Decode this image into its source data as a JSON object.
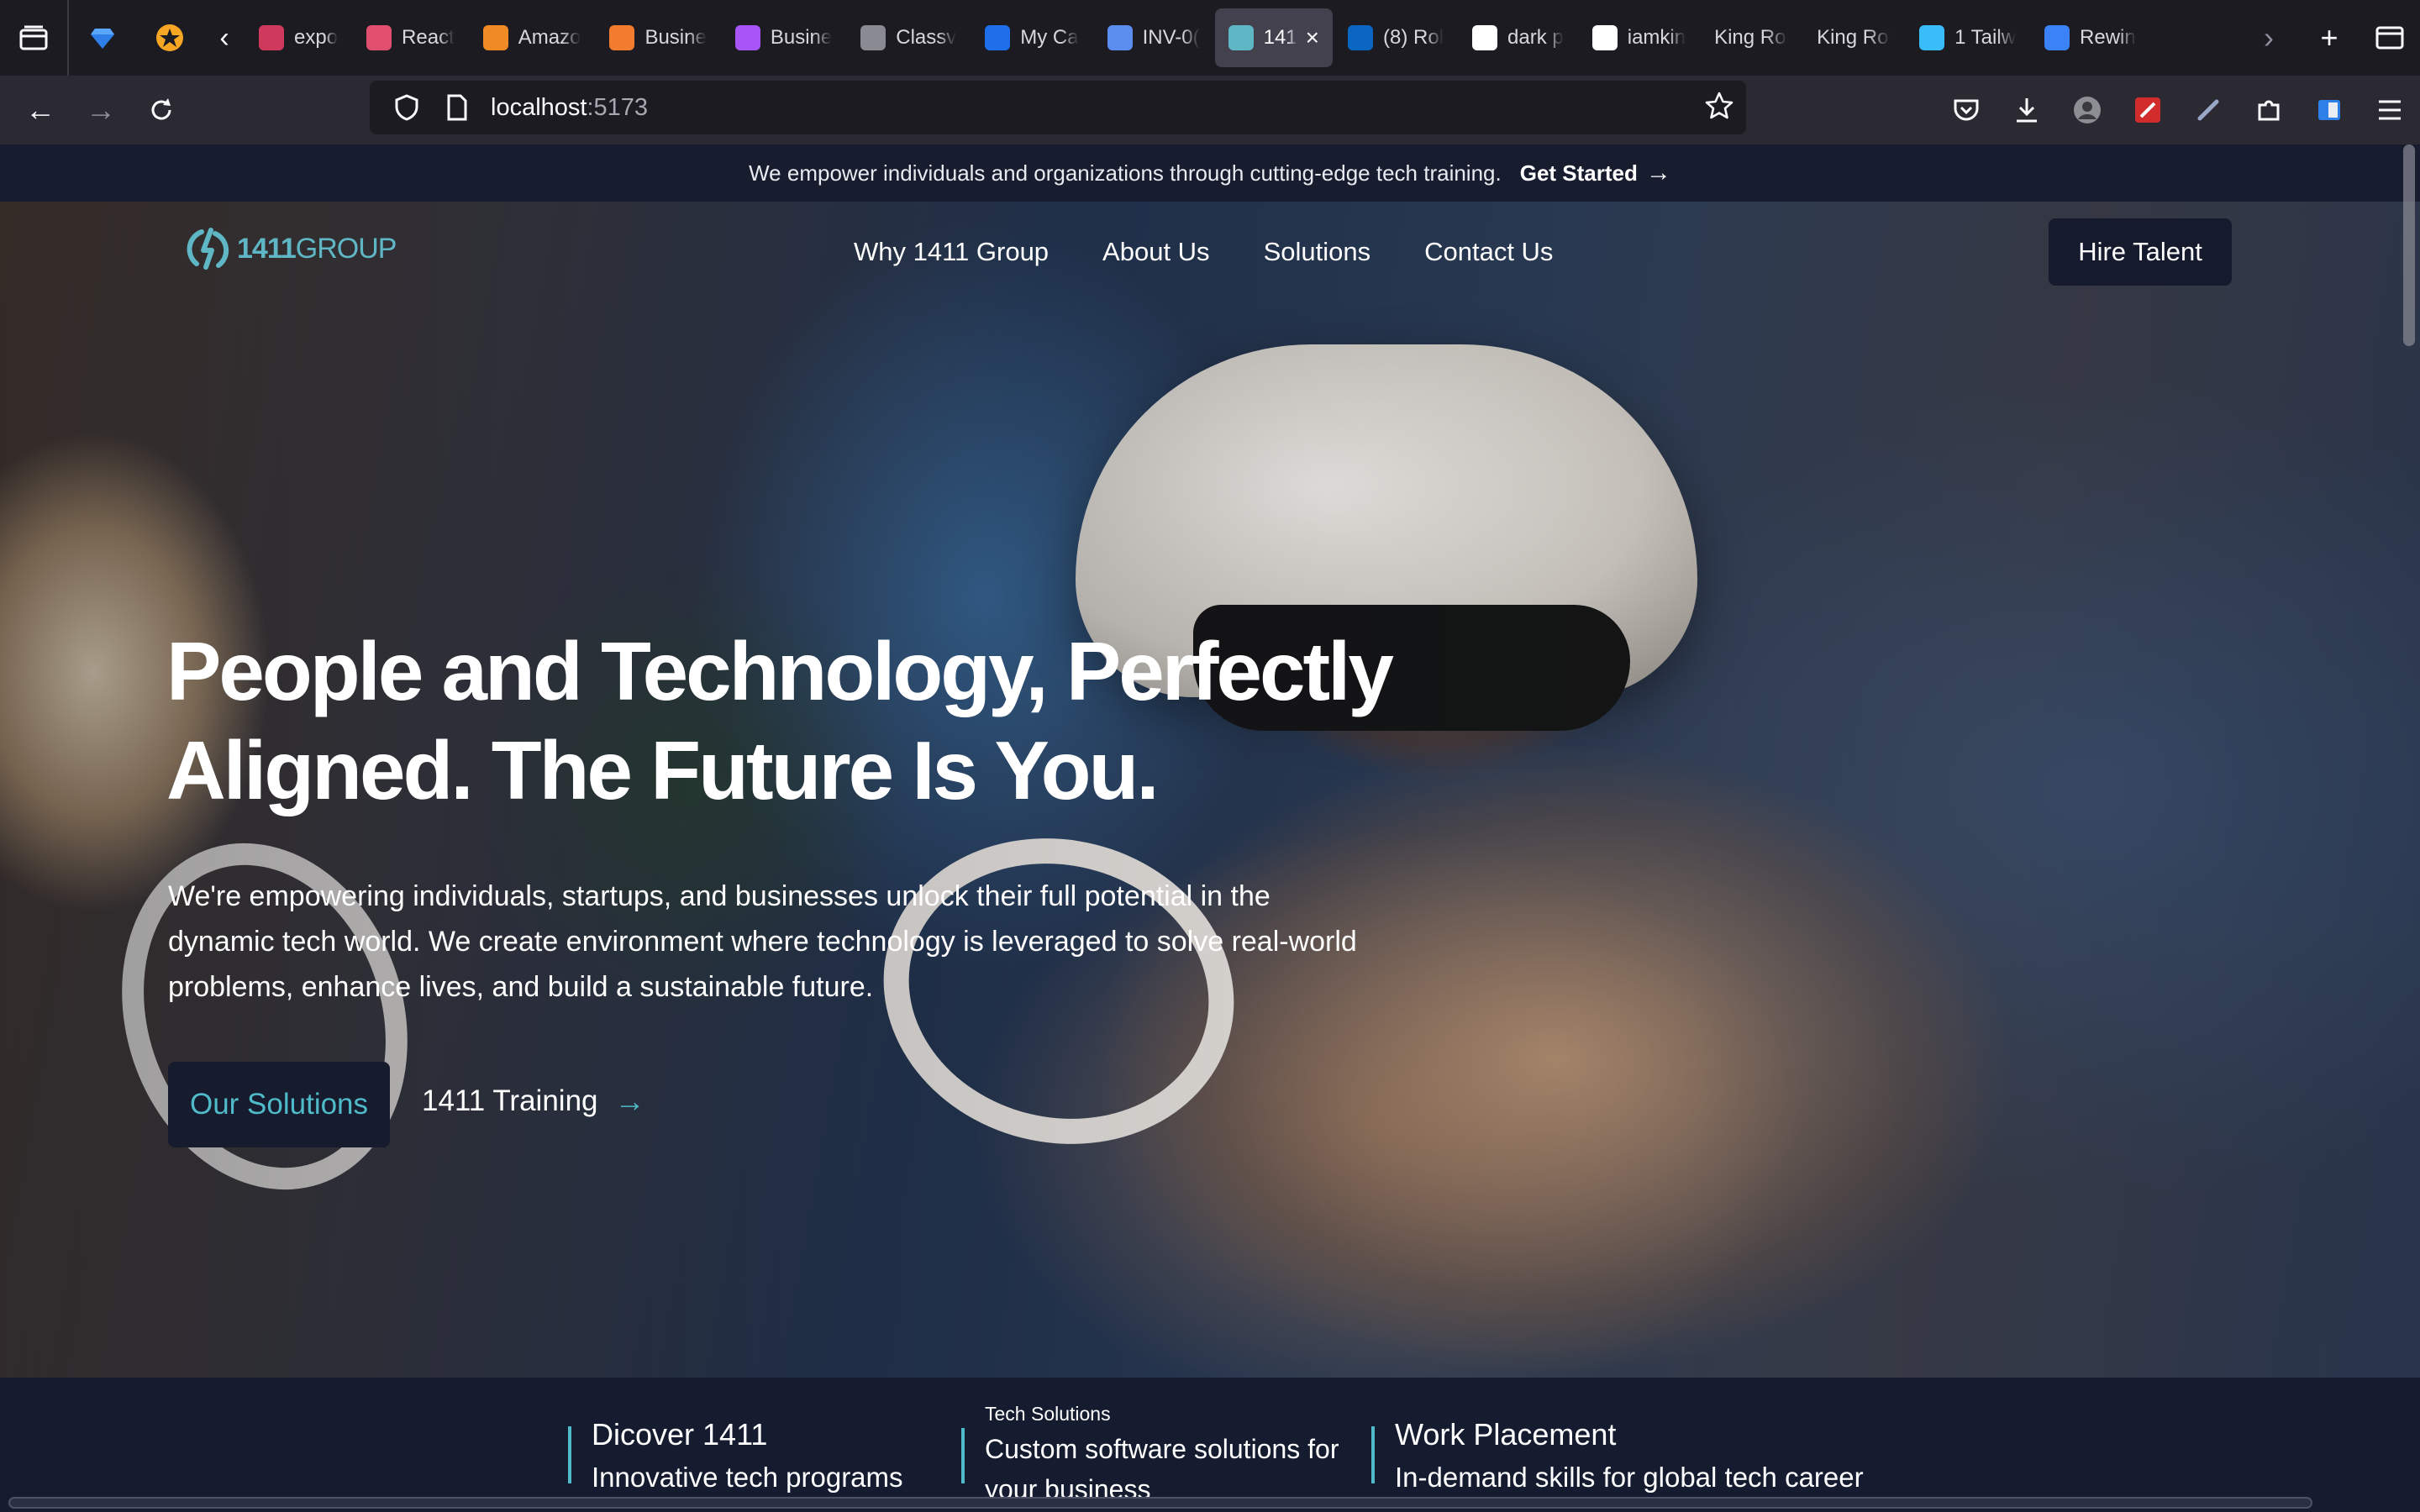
{
  "browser": {
    "tabs": [
      {
        "title": "expo",
        "favicon_color": "#cf3a5c",
        "icon": "expo-icon"
      },
      {
        "title": "React",
        "favicon_color": "#e04f6e",
        "icon": "react-icon"
      },
      {
        "title": "Amazo",
        "favicon_color": "#f08a24",
        "icon": "aws-icon"
      },
      {
        "title": "Busine",
        "favicon_color": "#f27b2e",
        "icon": "business-icon"
      },
      {
        "title": "Busine",
        "favicon_color": "#a855f7",
        "icon": "business-icon"
      },
      {
        "title": "Classv",
        "favicon_color": "#8a8a93",
        "icon": "classroom-icon"
      },
      {
        "title": "My Ca",
        "favicon_color": "#1f6feb",
        "icon": "calendly-icon"
      },
      {
        "title": "INV-0(",
        "favicon_color": "#5b8def",
        "icon": "invoice-icon"
      },
      {
        "title": "141",
        "favicon_color": "#5fb7c6",
        "icon": "1411-icon",
        "active": true
      },
      {
        "title": "(8) Rol",
        "favicon_color": "#0a66c2",
        "icon": "linkedin-icon"
      },
      {
        "title": "dark p",
        "favicon_color": "#ffffff",
        "icon": "google-icon"
      },
      {
        "title": "iamkin",
        "favicon_color": "#ffffff",
        "icon": "github-icon"
      },
      {
        "title": "King Robe",
        "favicon_color": "",
        "icon": ""
      },
      {
        "title": "King Robe",
        "favicon_color": "",
        "icon": ""
      },
      {
        "title": "1 Tailw",
        "favicon_color": "#38bdf8",
        "icon": "tailwind-icon"
      },
      {
        "title": "Rewin",
        "favicon_color": "#3b82f6",
        "icon": "dot-icon"
      }
    ],
    "url": {
      "host": "localhost",
      "port": ":5173"
    }
  },
  "announcement": {
    "text": "We empower individuals and organizations through cutting-edge tech training.",
    "cta": "Get Started",
    "cta_arrow": "→"
  },
  "header": {
    "logo_number": "1411",
    "logo_word": "GROUP",
    "nav": [
      "Why 1411 Group",
      "About Us",
      "Solutions",
      "Contact Us"
    ],
    "hire_button": "Hire Talent"
  },
  "hero": {
    "title_line1": "People and Technology, Perfectly",
    "title_line2": "Aligned. The Future Is You.",
    "subtitle": "We're empowering individuals, startups, and businesses unlock their full potential in the dynamic tech world. We create environment where technology is leveraged to solve real-world problems, enhance lives, and build a sustainable future.",
    "primary_button": "Our Solutions",
    "secondary_button": "1411 Training",
    "secondary_arrow": "→"
  },
  "features": [
    {
      "title": "Dicover 1411",
      "desc": "Innovative tech programs"
    },
    {
      "title": "Tech Solutions",
      "desc": "Custom software solutions for your business"
    },
    {
      "title": "Work Placement",
      "desc": "In-demand skills for global tech career"
    }
  ],
  "colors": {
    "accent": "#4fbac8",
    "logo": "#5fb7c6",
    "navy": "#161b2d"
  }
}
